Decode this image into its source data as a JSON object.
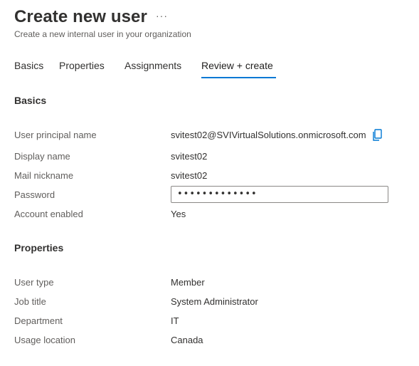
{
  "header": {
    "title": "Create new user",
    "more_label": "···",
    "subtitle": "Create a new internal user in your organization"
  },
  "tabs": [
    {
      "label": "Basics"
    },
    {
      "label": "Properties"
    },
    {
      "label": "Assignments"
    },
    {
      "label": "Review + create",
      "active": true
    }
  ],
  "basics": {
    "heading": "Basics",
    "rows": [
      {
        "label": "User principal name",
        "value": "svitest02@SVIVirtualSolutions.onmicrosoft.com"
      },
      {
        "label": "Display name",
        "value": "svitest02"
      },
      {
        "label": "Mail nickname",
        "value": "svitest02"
      },
      {
        "label": "Password",
        "value": "•••••••••••••"
      },
      {
        "label": "Account enabled",
        "value": "Yes"
      }
    ]
  },
  "properties": {
    "heading": "Properties",
    "rows": [
      {
        "label": "User type",
        "value": "Member"
      },
      {
        "label": "Job title",
        "value": "System Administrator"
      },
      {
        "label": "Department",
        "value": "IT"
      },
      {
        "label": "Usage location",
        "value": "Canada"
      }
    ]
  },
  "icons": {
    "copy": "copy-icon",
    "more": "more-icon"
  },
  "colors": {
    "accent": "#0078d4",
    "text": "#323130",
    "label": "#605e5c"
  }
}
